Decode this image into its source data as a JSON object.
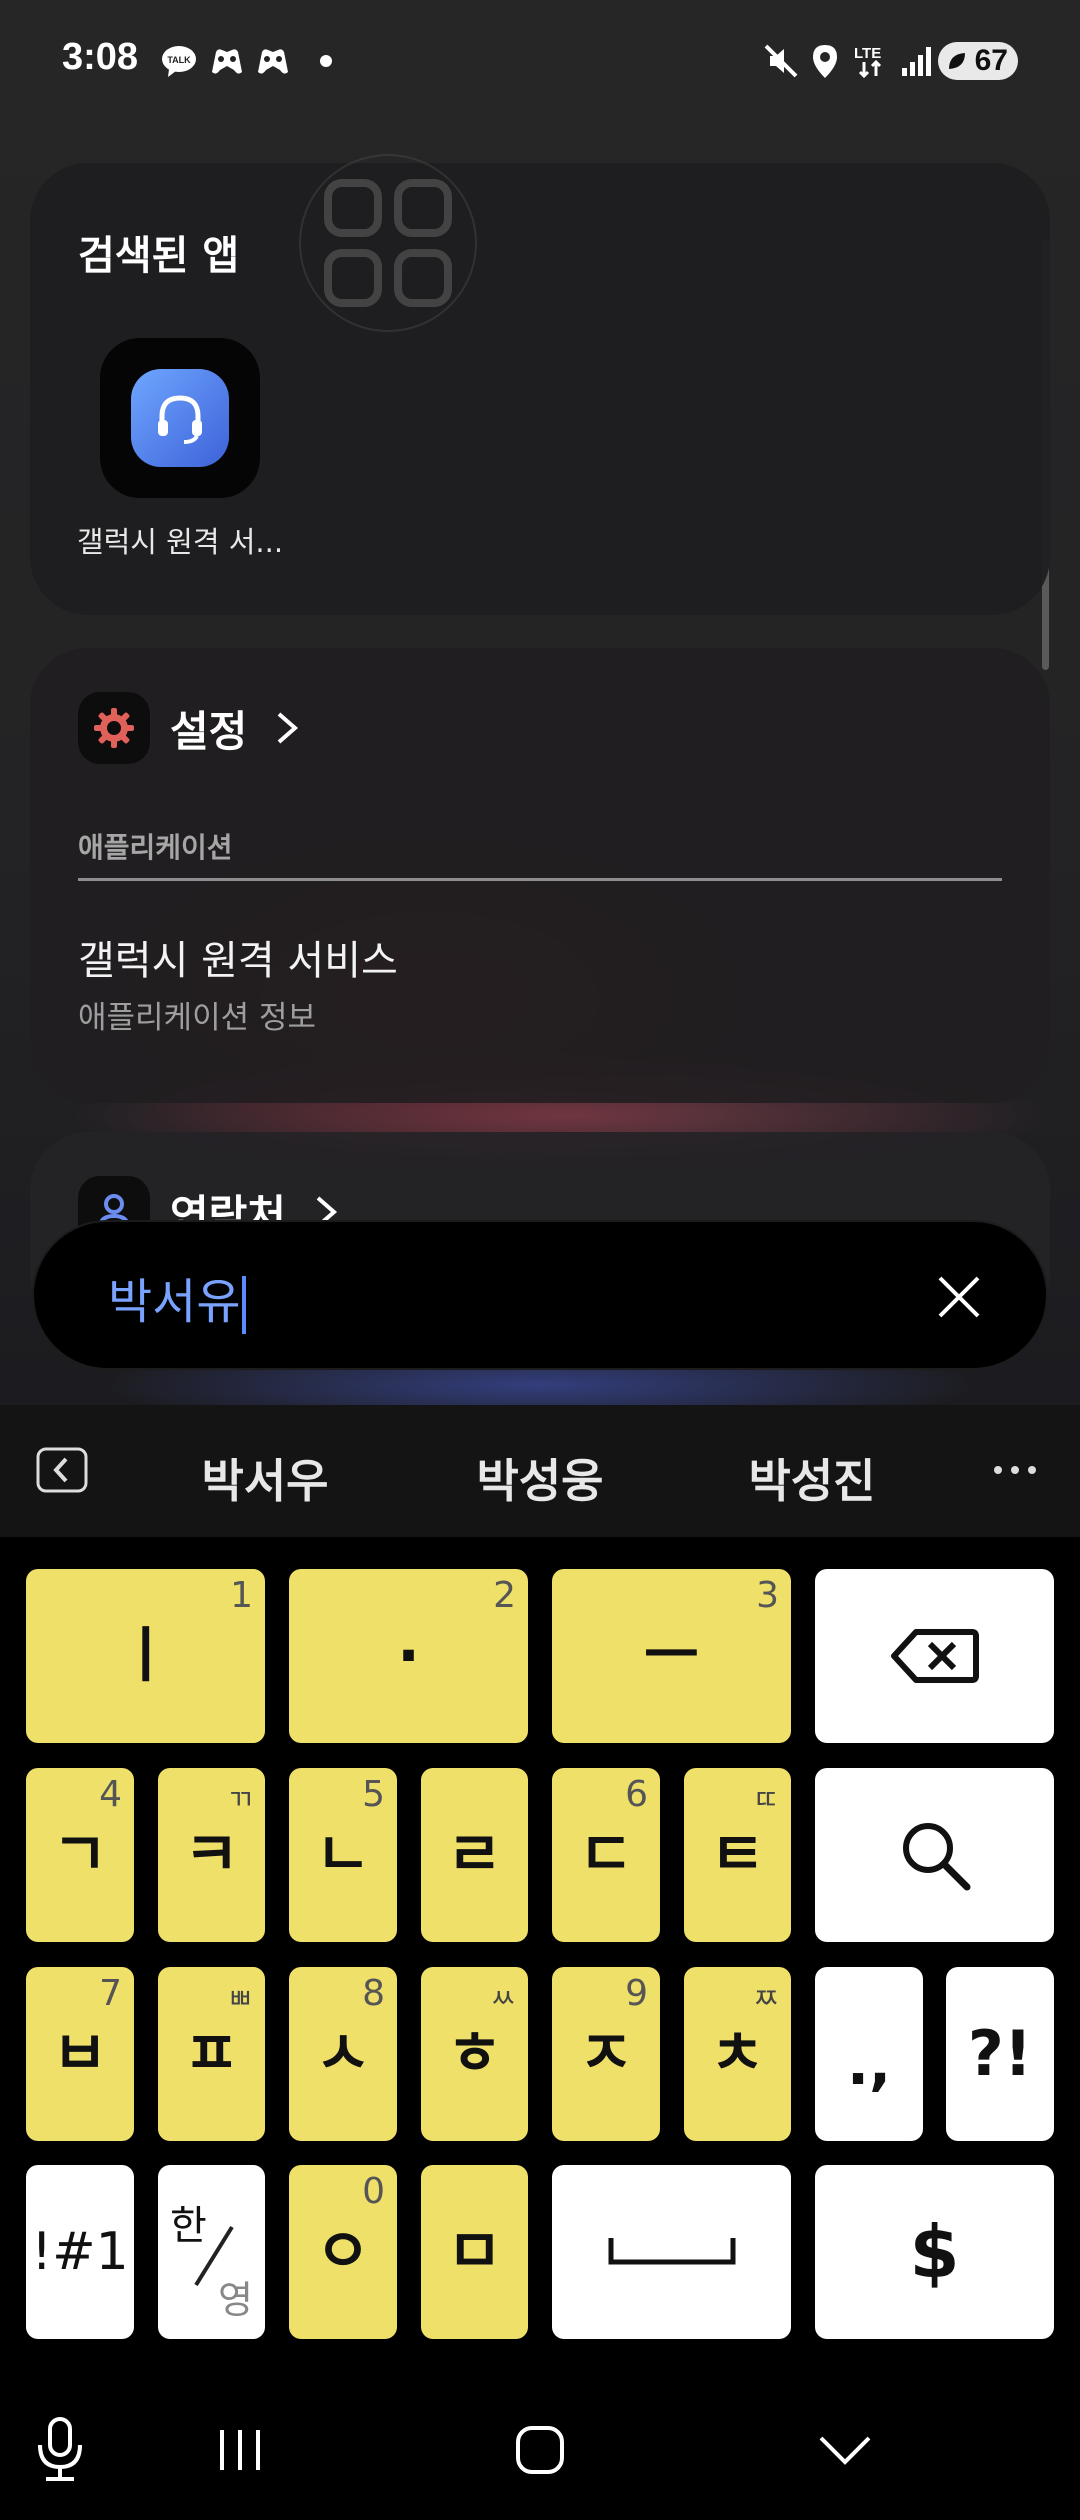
{
  "status_bar": {
    "time": "3:08",
    "battery": "67",
    "network": "LTE"
  },
  "apps_card": {
    "title": "검색된 앱",
    "app_label": "갤럭시 원격 서..."
  },
  "settings_card": {
    "title": "설정",
    "subheader": "애플리케이션",
    "result_title": "갤럭시 원격 서비스",
    "result_subtitle": "애플리케이션 정보"
  },
  "contacts_card": {
    "title": "연락처"
  },
  "search": {
    "query": "박서유"
  },
  "suggestions": [
    "박서우",
    "박성웅",
    "박성진"
  ],
  "keyboard": {
    "row1": [
      {
        "main": "ㅣ",
        "sup": "1"
      },
      {
        "main": "·",
        "sup": "2"
      },
      {
        "main": "ㅡ",
        "sup": "3"
      }
    ],
    "row2": [
      {
        "main": "ㄱ",
        "sup": "4"
      },
      {
        "main": "ㅋ",
        "sup": "ㄲ"
      },
      {
        "main": "ㄴ",
        "sup": "5"
      },
      {
        "main": "ㄹ",
        "sup": ""
      },
      {
        "main": "ㄷ",
        "sup": "6"
      },
      {
        "main": "ㅌ",
        "sup": "ㄸ"
      }
    ],
    "row3": [
      {
        "main": "ㅂ",
        "sup": "7"
      },
      {
        "main": "ㅍ",
        "sup": "ㅃ"
      },
      {
        "main": "ㅅ",
        "sup": "8"
      },
      {
        "main": "ㅎ",
        "sup": "ㅆ"
      },
      {
        "main": "ㅈ",
        "sup": "9"
      },
      {
        "main": "ㅊ",
        "sup": "ㅉ"
      }
    ],
    "punct1": ".,",
    "punct2": "?!",
    "symbols": "!#1",
    "lang_top": "한",
    "lang_bottom": "영",
    "ieung": {
      "main": "ㅇ",
      "sup": "0"
    },
    "mieum": {
      "main": "ㅁ"
    },
    "currency": "$"
  }
}
